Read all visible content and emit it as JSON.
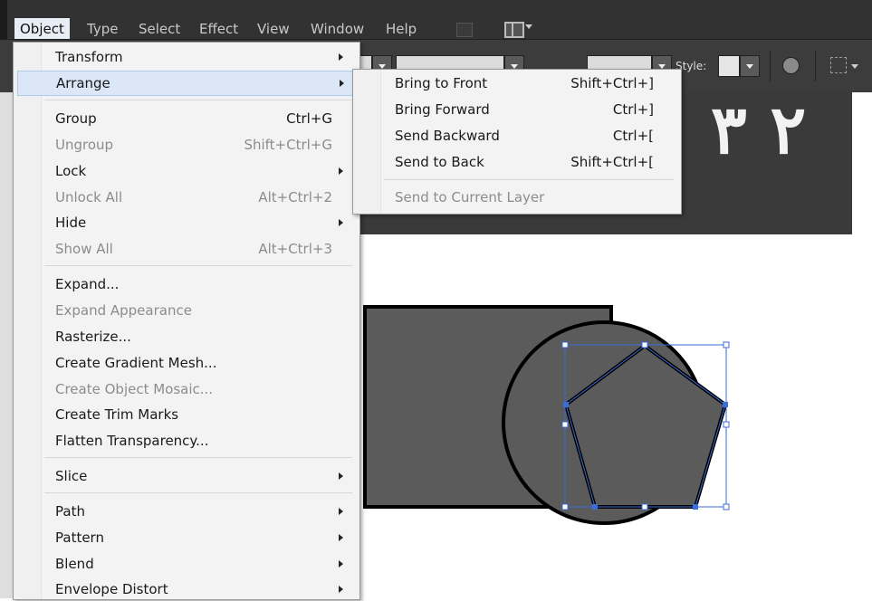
{
  "menubar": {
    "items": [
      "Object",
      "Type",
      "Select",
      "Effect",
      "View",
      "Window",
      "Help"
    ],
    "icons": [
      "bridge-icon",
      "arrange-documents-icon"
    ]
  },
  "toolbar": {
    "style_label": "Style:"
  },
  "document": {
    "header_text": "٢ ٣"
  },
  "object_menu": {
    "items": [
      {
        "label": "Transform",
        "shortcut": "",
        "submenu": true,
        "disabled": false
      },
      {
        "label": "Arrange",
        "shortcut": "",
        "submenu": true,
        "disabled": false,
        "highlighted": true
      },
      {
        "label": "Group",
        "shortcut": "Ctrl+G",
        "submenu": false,
        "disabled": false
      },
      {
        "label": "Ungroup",
        "shortcut": "Shift+Ctrl+G",
        "submenu": false,
        "disabled": true
      },
      {
        "label": "Lock",
        "shortcut": "",
        "submenu": true,
        "disabled": false
      },
      {
        "label": "Unlock All",
        "shortcut": "Alt+Ctrl+2",
        "submenu": false,
        "disabled": true
      },
      {
        "label": "Hide",
        "shortcut": "",
        "submenu": true,
        "disabled": false
      },
      {
        "label": "Show All",
        "shortcut": "Alt+Ctrl+3",
        "submenu": false,
        "disabled": true
      },
      {
        "label": "Expand...",
        "shortcut": "",
        "submenu": false,
        "disabled": false
      },
      {
        "label": "Expand Appearance",
        "shortcut": "",
        "submenu": false,
        "disabled": true
      },
      {
        "label": "Rasterize...",
        "shortcut": "",
        "submenu": false,
        "disabled": false
      },
      {
        "label": "Create Gradient Mesh...",
        "shortcut": "",
        "submenu": false,
        "disabled": false
      },
      {
        "label": "Create Object Mosaic...",
        "shortcut": "",
        "submenu": false,
        "disabled": true
      },
      {
        "label": "Create Trim Marks",
        "shortcut": "",
        "submenu": false,
        "disabled": false
      },
      {
        "label": "Flatten Transparency...",
        "shortcut": "",
        "submenu": false,
        "disabled": false
      },
      {
        "label": "Slice",
        "shortcut": "",
        "submenu": true,
        "disabled": false
      },
      {
        "label": "Path",
        "shortcut": "",
        "submenu": true,
        "disabled": false
      },
      {
        "label": "Pattern",
        "shortcut": "",
        "submenu": true,
        "disabled": false
      },
      {
        "label": "Blend",
        "shortcut": "",
        "submenu": true,
        "disabled": false
      },
      {
        "label": "Envelope Distort",
        "shortcut": "",
        "submenu": true,
        "disabled": false
      }
    ]
  },
  "arrange_submenu": {
    "items": [
      {
        "label": "Bring to Front",
        "shortcut": "Shift+Ctrl+]",
        "disabled": false
      },
      {
        "label": "Bring Forward",
        "shortcut": "Ctrl+]",
        "disabled": false
      },
      {
        "label": "Send Backward",
        "shortcut": "Ctrl+[",
        "disabled": false
      },
      {
        "label": "Send to Back",
        "shortcut": "Shift+Ctrl+[",
        "disabled": false
      },
      {
        "label": "Send to Current Layer",
        "shortcut": "",
        "disabled": true
      }
    ]
  },
  "colors": {
    "menubar_bg": "#323232",
    "menu_bg": "#f3f3f3",
    "highlight": "#dbe7f7",
    "shape_fill": "#5b5b5b",
    "selection": "#3a6ed8"
  }
}
